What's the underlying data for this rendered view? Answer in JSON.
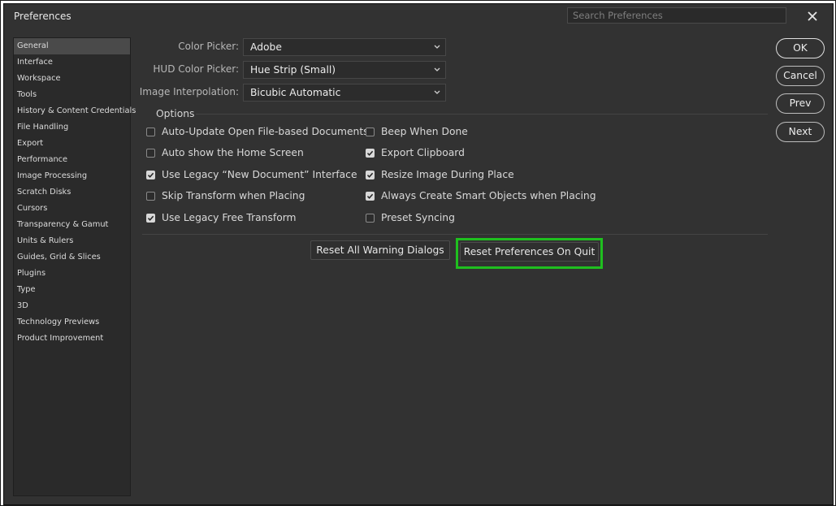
{
  "window": {
    "title": "Preferences",
    "search_placeholder": "Search Preferences"
  },
  "sidebar": {
    "active": "General",
    "items": [
      "General",
      "Interface",
      "Workspace",
      "Tools",
      "History & Content Credentials",
      "File Handling",
      "Export",
      "Performance",
      "Image Processing",
      "Scratch Disks",
      "Cursors",
      "Transparency & Gamut",
      "Units & Rulers",
      "Guides, Grid & Slices",
      "Plugins",
      "Type",
      "3D",
      "Technology Previews",
      "Product Improvement"
    ]
  },
  "fields": {
    "color_picker": {
      "label": "Color Picker:",
      "value": "Adobe"
    },
    "hud_color_picker": {
      "label": "HUD Color Picker:",
      "value": "Hue Strip (Small)"
    },
    "image_interpolation": {
      "label": "Image Interpolation:",
      "value": "Bicubic Automatic"
    }
  },
  "options": {
    "label": "Options",
    "left": [
      {
        "label": "Auto-Update Open File-based Documents",
        "checked": false
      },
      {
        "label": "Auto show the Home Screen",
        "checked": false
      },
      {
        "label": "Use Legacy “New Document” Interface",
        "checked": true
      },
      {
        "label": "Skip Transform when Placing",
        "checked": false
      },
      {
        "label": "Use Legacy Free Transform",
        "checked": true
      }
    ],
    "right": [
      {
        "label": "Beep When Done",
        "checked": false
      },
      {
        "label": "Export Clipboard",
        "checked": true
      },
      {
        "label": "Resize Image During Place",
        "checked": true
      },
      {
        "label": "Always Create Smart Objects when Placing",
        "checked": true
      },
      {
        "label": "Preset Syncing",
        "checked": false
      }
    ]
  },
  "actions": {
    "reset_warning": "Reset All Warning Dialogs",
    "reset_prefs": "Reset Preferences On Quit"
  },
  "side_buttons": {
    "ok": "OK",
    "cancel": "Cancel",
    "prev": "Prev",
    "next": "Next"
  },
  "colors": {
    "highlight": "#1fbf1f",
    "background": "#323232"
  }
}
